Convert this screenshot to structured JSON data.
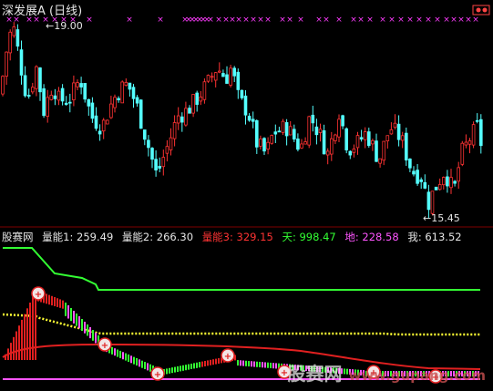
{
  "upper": {
    "title": "深发展A (日线)",
    "high_label": "19.00",
    "low_label": "15.45",
    "colors": {
      "up": "#ff3333",
      "down": "#54ffff",
      "signal": "#ff3cff"
    }
  },
  "lower": {
    "name": "股赛网",
    "items": [
      {
        "label": "量能1:",
        "value": "259.49",
        "color": "#e6e6e6"
      },
      {
        "label": "量能2:",
        "value": "266.30",
        "color": "#e6e6e6"
      },
      {
        "label": "量能3:",
        "value": "329.15",
        "color": "#ff3333"
      },
      {
        "label": "天:",
        "value": "998.47",
        "color": "#33ff33"
      },
      {
        "label": "地:",
        "value": "228.58",
        "color": "#ff55ff"
      },
      {
        "label": "我:",
        "value": "613.52",
        "color": "#e6e6e6"
      }
    ]
  },
  "watermark": {
    "text": "股赛网",
    "url": "www.gupang.com"
  },
  "chart_data": {
    "type": "line",
    "series": [
      {
        "name": "天",
        "values": [
          998.47
        ]
      },
      {
        "name": "地",
        "values": [
          228.58
        ]
      },
      {
        "name": "我",
        "values": [
          613.52
        ]
      }
    ],
    "price_high": 19.0,
    "price_low": 15.45
  }
}
